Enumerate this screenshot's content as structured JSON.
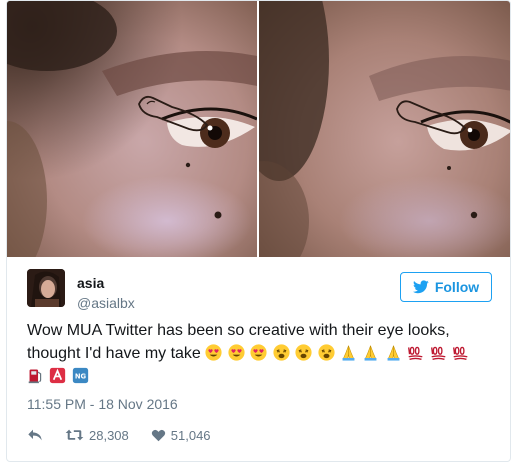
{
  "tweet": {
    "display_name": "asia",
    "handle": "@asialbx",
    "follow_label": "Follow",
    "text_line1": "Wow MUA Twitter has been so creative with their eye looks,",
    "text_line2": "thought I'd have my take",
    "emojis": [
      "heart-eyes",
      "heart-eyes",
      "heart-eyes",
      "weary-face",
      "weary-face",
      "weary-face",
      "folded-hands",
      "folded-hands",
      "folded-hands",
      "hundred-points",
      "hundred-points",
      "hundred-points",
      "fuel-pump",
      "a-button",
      "ng-button"
    ],
    "timestamp": "11:55 PM - 18 Nov 2016",
    "retweet_count": "28,308",
    "like_count": "51,046"
  },
  "icons": {
    "follow": "twitter-bird-icon",
    "reply": "reply-arrow-icon",
    "retweet": "retweet-icon",
    "like": "heart-icon"
  },
  "colors": {
    "brand_blue": "#1da1f2",
    "text": "#14171a",
    "muted": "#657786",
    "border": "#e1e8ed"
  }
}
